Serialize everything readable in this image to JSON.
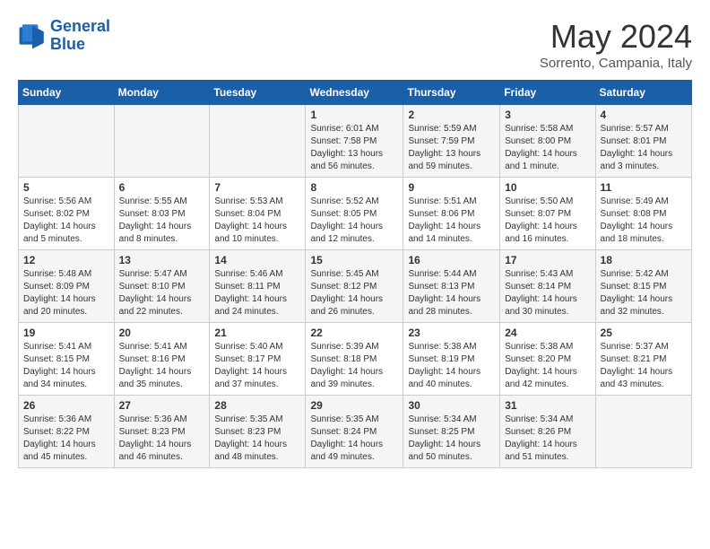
{
  "logo": {
    "line1": "General",
    "line2": "Blue"
  },
  "title": "May 2024",
  "location": "Sorrento, Campania, Italy",
  "days_of_week": [
    "Sunday",
    "Monday",
    "Tuesday",
    "Wednesday",
    "Thursday",
    "Friday",
    "Saturday"
  ],
  "weeks": [
    [
      {
        "day": "",
        "detail": ""
      },
      {
        "day": "",
        "detail": ""
      },
      {
        "day": "",
        "detail": ""
      },
      {
        "day": "1",
        "detail": "Sunrise: 6:01 AM\nSunset: 7:58 PM\nDaylight: 13 hours\nand 56 minutes."
      },
      {
        "day": "2",
        "detail": "Sunrise: 5:59 AM\nSunset: 7:59 PM\nDaylight: 13 hours\nand 59 minutes."
      },
      {
        "day": "3",
        "detail": "Sunrise: 5:58 AM\nSunset: 8:00 PM\nDaylight: 14 hours\nand 1 minute."
      },
      {
        "day": "4",
        "detail": "Sunrise: 5:57 AM\nSunset: 8:01 PM\nDaylight: 14 hours\nand 3 minutes."
      }
    ],
    [
      {
        "day": "5",
        "detail": "Sunrise: 5:56 AM\nSunset: 8:02 PM\nDaylight: 14 hours\nand 5 minutes."
      },
      {
        "day": "6",
        "detail": "Sunrise: 5:55 AM\nSunset: 8:03 PM\nDaylight: 14 hours\nand 8 minutes."
      },
      {
        "day": "7",
        "detail": "Sunrise: 5:53 AM\nSunset: 8:04 PM\nDaylight: 14 hours\nand 10 minutes."
      },
      {
        "day": "8",
        "detail": "Sunrise: 5:52 AM\nSunset: 8:05 PM\nDaylight: 14 hours\nand 12 minutes."
      },
      {
        "day": "9",
        "detail": "Sunrise: 5:51 AM\nSunset: 8:06 PM\nDaylight: 14 hours\nand 14 minutes."
      },
      {
        "day": "10",
        "detail": "Sunrise: 5:50 AM\nSunset: 8:07 PM\nDaylight: 14 hours\nand 16 minutes."
      },
      {
        "day": "11",
        "detail": "Sunrise: 5:49 AM\nSunset: 8:08 PM\nDaylight: 14 hours\nand 18 minutes."
      }
    ],
    [
      {
        "day": "12",
        "detail": "Sunrise: 5:48 AM\nSunset: 8:09 PM\nDaylight: 14 hours\nand 20 minutes."
      },
      {
        "day": "13",
        "detail": "Sunrise: 5:47 AM\nSunset: 8:10 PM\nDaylight: 14 hours\nand 22 minutes."
      },
      {
        "day": "14",
        "detail": "Sunrise: 5:46 AM\nSunset: 8:11 PM\nDaylight: 14 hours\nand 24 minutes."
      },
      {
        "day": "15",
        "detail": "Sunrise: 5:45 AM\nSunset: 8:12 PM\nDaylight: 14 hours\nand 26 minutes."
      },
      {
        "day": "16",
        "detail": "Sunrise: 5:44 AM\nSunset: 8:13 PM\nDaylight: 14 hours\nand 28 minutes."
      },
      {
        "day": "17",
        "detail": "Sunrise: 5:43 AM\nSunset: 8:14 PM\nDaylight: 14 hours\nand 30 minutes."
      },
      {
        "day": "18",
        "detail": "Sunrise: 5:42 AM\nSunset: 8:15 PM\nDaylight: 14 hours\nand 32 minutes."
      }
    ],
    [
      {
        "day": "19",
        "detail": "Sunrise: 5:41 AM\nSunset: 8:15 PM\nDaylight: 14 hours\nand 34 minutes."
      },
      {
        "day": "20",
        "detail": "Sunrise: 5:41 AM\nSunset: 8:16 PM\nDaylight: 14 hours\nand 35 minutes."
      },
      {
        "day": "21",
        "detail": "Sunrise: 5:40 AM\nSunset: 8:17 PM\nDaylight: 14 hours\nand 37 minutes."
      },
      {
        "day": "22",
        "detail": "Sunrise: 5:39 AM\nSunset: 8:18 PM\nDaylight: 14 hours\nand 39 minutes."
      },
      {
        "day": "23",
        "detail": "Sunrise: 5:38 AM\nSunset: 8:19 PM\nDaylight: 14 hours\nand 40 minutes."
      },
      {
        "day": "24",
        "detail": "Sunrise: 5:38 AM\nSunset: 8:20 PM\nDaylight: 14 hours\nand 42 minutes."
      },
      {
        "day": "25",
        "detail": "Sunrise: 5:37 AM\nSunset: 8:21 PM\nDaylight: 14 hours\nand 43 minutes."
      }
    ],
    [
      {
        "day": "26",
        "detail": "Sunrise: 5:36 AM\nSunset: 8:22 PM\nDaylight: 14 hours\nand 45 minutes."
      },
      {
        "day": "27",
        "detail": "Sunrise: 5:36 AM\nSunset: 8:23 PM\nDaylight: 14 hours\nand 46 minutes."
      },
      {
        "day": "28",
        "detail": "Sunrise: 5:35 AM\nSunset: 8:23 PM\nDaylight: 14 hours\nand 48 minutes."
      },
      {
        "day": "29",
        "detail": "Sunrise: 5:35 AM\nSunset: 8:24 PM\nDaylight: 14 hours\nand 49 minutes."
      },
      {
        "day": "30",
        "detail": "Sunrise: 5:34 AM\nSunset: 8:25 PM\nDaylight: 14 hours\nand 50 minutes."
      },
      {
        "day": "31",
        "detail": "Sunrise: 5:34 AM\nSunset: 8:26 PM\nDaylight: 14 hours\nand 51 minutes."
      },
      {
        "day": "",
        "detail": ""
      }
    ]
  ]
}
